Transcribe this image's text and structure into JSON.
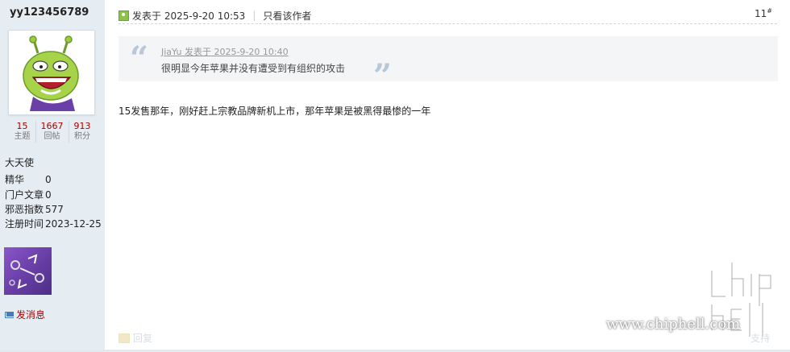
{
  "user": {
    "name": "yy123456789",
    "stats": [
      {
        "value": "15",
        "label": "主题"
      },
      {
        "value": "1667",
        "label": "回帖"
      },
      {
        "value": "913",
        "label": "积分"
      }
    ],
    "rank": "大天使",
    "info": [
      {
        "key": "精华",
        "value": "0"
      },
      {
        "key": "门户文章",
        "value": "0"
      },
      {
        "key": "邪恶指数",
        "value": "577"
      },
      {
        "key": "注册时间",
        "value": "2023-12-25"
      }
    ],
    "send_message": "发消息"
  },
  "post": {
    "posted_at": "发表于 2025-9-20 10:53",
    "separator": "|",
    "only_author": "只看该作者",
    "floor": "11",
    "floor_mark": "#",
    "quote": {
      "author_line": "JiaYu 发表于 2025-9-20 10:40",
      "text": "很明显今年苹果并没有遭受到有组织的攻击",
      "open_mark": "“",
      "close_mark": "”"
    },
    "body": "15发售那年，刚好赶上宗教品牌新机上市，那年苹果是被黑得最惨的一年",
    "reply_label": "回复",
    "support_label": "支持"
  },
  "watermark": {
    "site": "www.chiphell.com",
    "logo": "chip hell"
  },
  "colors": {
    "sidebar_bg": "#e5edf2",
    "accent_red": "#a00000",
    "quote_bg": "#f3f5f7"
  },
  "icons": [
    "online-status-icon",
    "envelope-icon",
    "reply-icon",
    "user-avatar",
    "medal-badge"
  ]
}
